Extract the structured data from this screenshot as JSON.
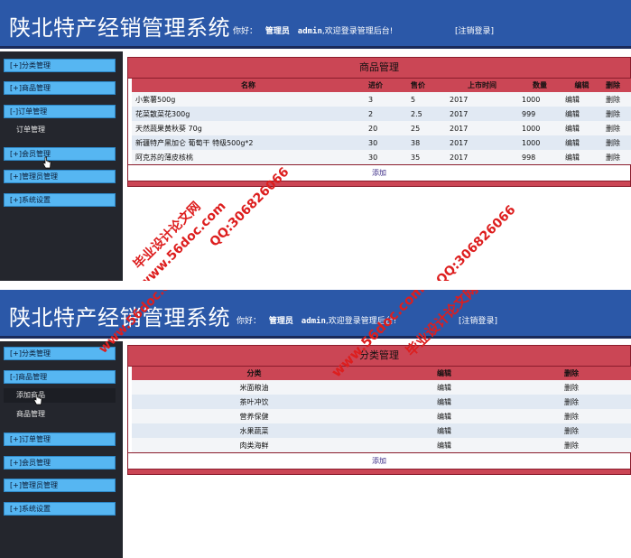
{
  "header": {
    "title": "陕北特产经销管理系统",
    "greeting": "你好：",
    "role": "管理员",
    "username": "admin",
    "welcome": ",欢迎登录管理后台!",
    "logout": "[注销登录]"
  },
  "screen1": {
    "sidebar": {
      "items": [
        {
          "label": "[+]分类管理"
        },
        {
          "label": "[+]商品管理"
        },
        {
          "label": "[-]订单管理"
        },
        {
          "label": "订单管理"
        },
        {
          "label": "[+]会员管理"
        },
        {
          "label": "[+]管理员管理"
        },
        {
          "label": "[+]系统设置"
        }
      ]
    },
    "panel": {
      "title": "商品管理",
      "columns": [
        "名称",
        "进价",
        "售价",
        "上市时间",
        "数量",
        "编辑",
        "删除"
      ],
      "rows": [
        [
          "小紫薯500g",
          "3",
          "5",
          "2017",
          "1000",
          "编辑",
          "删除"
        ],
        [
          "花菜散菜花300g",
          "2",
          "2.5",
          "2017",
          "999",
          "编辑",
          "删除"
        ],
        [
          "天然蔬果黄秋葵 70g",
          "20",
          "25",
          "2017",
          "1000",
          "编辑",
          "删除"
        ],
        [
          "新疆特产黑加仑 葡萄干 特级500g*2",
          "30",
          "38",
          "2017",
          "1000",
          "编辑",
          "删除"
        ],
        [
          "阿克苏的薄皮核桃",
          "30",
          "35",
          "2017",
          "998",
          "编辑",
          "删除"
        ]
      ],
      "add": "添加"
    }
  },
  "screen2": {
    "sidebar": {
      "items": [
        {
          "label": "[+]分类管理"
        },
        {
          "label": "[-]商品管理"
        },
        {
          "label": "添加商品"
        },
        {
          "label": "商品管理"
        },
        {
          "label": "[+]订单管理"
        },
        {
          "label": "[+]会员管理"
        },
        {
          "label": "[+]管理员管理"
        },
        {
          "label": "[+]系统设置"
        }
      ]
    },
    "panel": {
      "title": "分类管理",
      "columns": [
        "分类",
        "编辑",
        "删除"
      ],
      "rows": [
        [
          "米面粮油",
          "编辑",
          "删除"
        ],
        [
          "茶叶冲饮",
          "编辑",
          "删除"
        ],
        [
          "营养保健",
          "编辑",
          "删除"
        ],
        [
          "水果蔬菜",
          "编辑",
          "删除"
        ],
        [
          "肉类海鲜",
          "编辑",
          "删除"
        ]
      ],
      "add": "添加"
    }
  },
  "watermarks": {
    "site": "www.56doc.com",
    "name": "毕业设计论文网",
    "qq": "QQ:306826066"
  }
}
